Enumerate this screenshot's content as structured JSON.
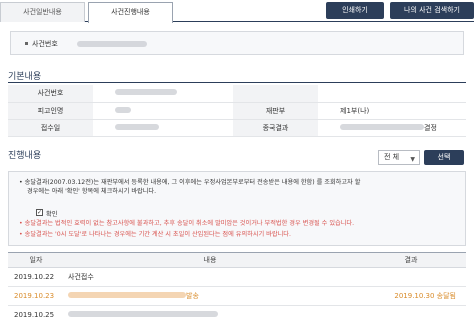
{
  "tabs": [
    {
      "label": "사건일반내용"
    },
    {
      "label": "사건진행내용"
    }
  ],
  "top_buttons": {
    "print": "인쇄하기",
    "my_case_search": "나의 사건 검색하기"
  },
  "case_box": {
    "label": "사건번호"
  },
  "basic_section": {
    "title": "기본내용",
    "rows": [
      {
        "label": "사건번호"
      },
      {
        "label": "피고인명",
        "label2": "재판부",
        "value2": "제1부(나)"
      },
      {
        "label": "접수일",
        "label2": "종국결과",
        "value2_suffix": "결정"
      }
    ]
  },
  "progress_section": {
    "title": "진행내용",
    "select_value": "전 체",
    "select_button": "선택",
    "notice_line1": "송달결과(2007.03.12전)는 재판부에서 등록한 내용에, 그 이후에는 우정사업본부로부터 전송받은 내용에 한함) 를 조회하고자 할",
    "notice_line2": "경우에는 아래 '확인' 항목에 체크하시기 바랍니다.",
    "confirm_label": "확인",
    "notice_red1": "송달결과는 법적인 효력이 없는 참고사항에 불과하고, 추후 송달이 취소에 말미암은 것이거나 부적법한 경우 변경될 수 있습니다.",
    "notice_red2": "송달결과는 '0시 도달'로 나타나는 경우에는 기간 계산 시 초일이 산입된다는 점에 유의하시기 바랍니다.",
    "table_headers": [
      "일자",
      "내용",
      "결과"
    ],
    "rows": [
      {
        "date": "2019.10.22",
        "content": "사건접수",
        "result": ""
      },
      {
        "date": "2019.10.23",
        "content_suffix": "발송",
        "result": "2019.10.30 송달됨"
      },
      {
        "date": "2019.10.25",
        "content": "",
        "result": ""
      }
    ]
  },
  "colors": {
    "navy": "#2c3e5a",
    "highlight_orange": "#d98c2b",
    "notice_red": "#d9534f"
  }
}
